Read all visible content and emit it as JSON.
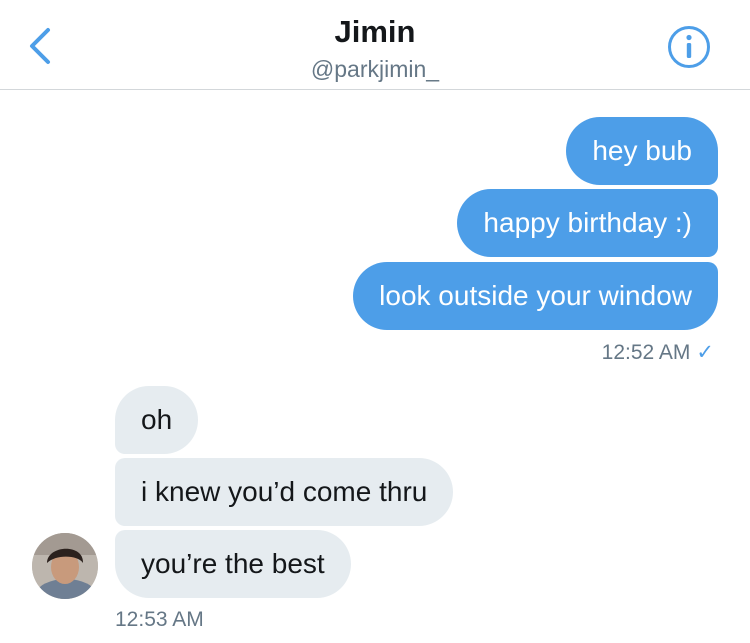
{
  "header": {
    "title": "Jimin",
    "handle": "@parkjimin_",
    "back_icon": "chevron-left-icon",
    "info_icon": "info-circle-icon"
  },
  "colors": {
    "accent": "#4d9ee8",
    "incoming_bubble": "#e6ecf0",
    "muted_text": "#657786"
  },
  "messages": {
    "outgoing": [
      {
        "text": "hey bub"
      },
      {
        "text": "happy birthday :)"
      },
      {
        "text": "look outside your window"
      }
    ],
    "outgoing_time": "12:52 AM",
    "outgoing_status_icon": "check-icon",
    "incoming": [
      {
        "text": "oh"
      },
      {
        "text": "i knew you’d come thru"
      },
      {
        "text": "you’re the best"
      }
    ],
    "incoming_time": "12:53 AM"
  }
}
